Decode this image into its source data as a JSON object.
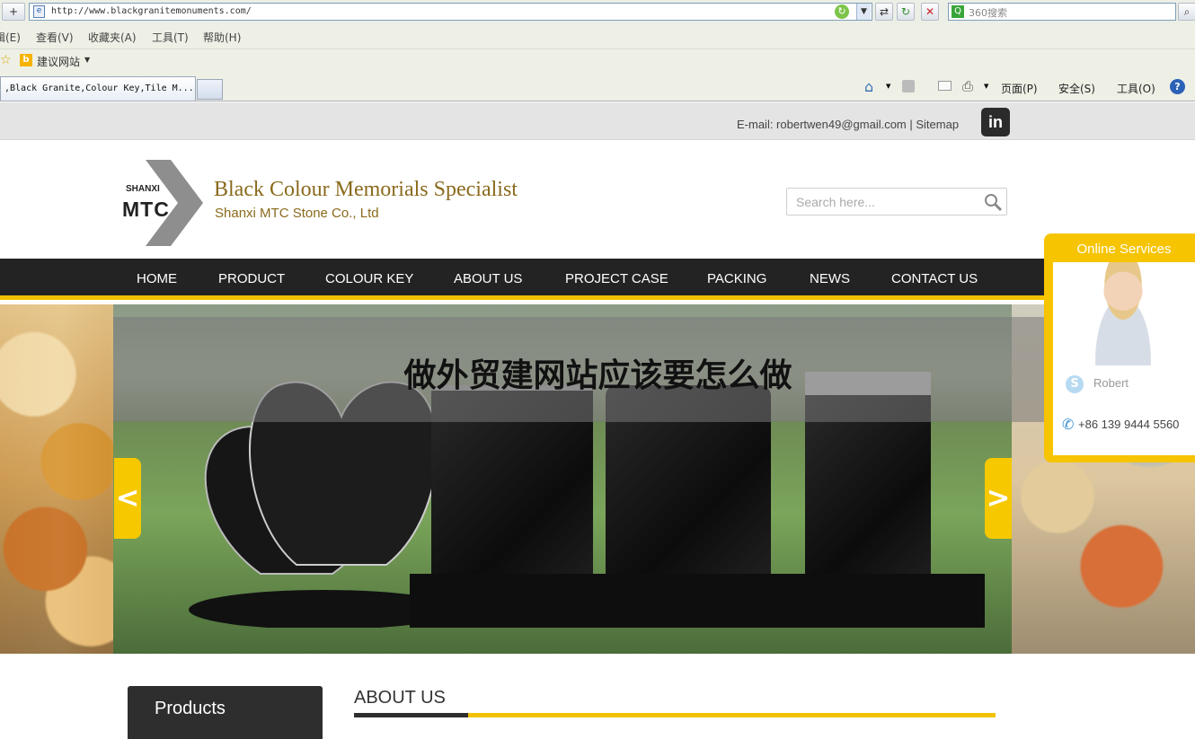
{
  "browser": {
    "url": "http://www.blackgranitemonuments.com/",
    "search_placeholder": "360搜索",
    "menu": [
      "辑(E)",
      "查看(V)",
      "收藏夹(A)",
      "工具(T)",
      "帮助(H)"
    ],
    "favorites_link": "建议网站",
    "tab_title": ",Black Granite,Colour Key,Tile M...",
    "command_bar": [
      "页面(P)",
      "安全(S)",
      "工具(O)"
    ]
  },
  "site": {
    "contact_line": "E-mail: robertwen49@gmail.com | Sitemap",
    "linkedin_label": "in",
    "logo_small": "SHANXI",
    "logo_big": "MTC",
    "slogan": "Black Colour Memorials Specialist",
    "company": "Shanxi MTC Stone Co., Ltd",
    "search_placeholder": "Search here...",
    "nav": [
      "HOME",
      "PRODUCT",
      "COLOUR KEY",
      "ABOUT US",
      "PROJECT CASE",
      "PACKING",
      "NEWS",
      "CONTACT US"
    ],
    "banner_title": "做外贸建网站应该要怎么做",
    "arrow_prev": "<",
    "arrow_next": ">",
    "products_heading": "Products",
    "about_heading": "ABOUT US"
  },
  "online_services": {
    "title": "Online Services",
    "name": "Robert",
    "phone": "+86 139 9444 5560"
  },
  "colors": {
    "accent": "#f2c200",
    "nav_bg": "#232323",
    "brand_gold": "#8a6a1c"
  }
}
